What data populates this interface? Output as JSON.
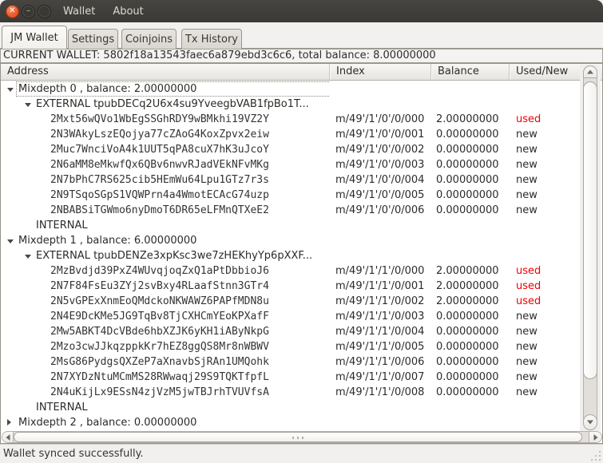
{
  "titlebar": {
    "menu": [
      "Wallet",
      "About"
    ]
  },
  "tabs": {
    "items": [
      "JM Wallet",
      "Settings",
      "Coinjoins",
      "Tx History"
    ],
    "active": "JM Wallet"
  },
  "wallet_info": "CURRENT WALLET: 5802f18a13543faec6a879ebd3c6c6, total balance: 8.00000000",
  "colors": {
    "used": "#ee0000",
    "new": "#2c2b28",
    "close_button": "#ec5b2f"
  },
  "tree": {
    "columns": [
      "Address",
      "Index",
      "Balance",
      "Used/New"
    ],
    "rows": [
      {
        "level": 0,
        "expander": "expanded",
        "label": "Mixdepth 0 , balance: 2.00000000",
        "index": "",
        "balance": "",
        "status": "",
        "focused": true
      },
      {
        "level": 1,
        "expander": "expanded",
        "label": "EXTERNAL tpubDECq2U6x4su9YveegbVAB1fpBo1T...",
        "index": "",
        "balance": "",
        "status": ""
      },
      {
        "level": 2,
        "mono": true,
        "label": "2Mxt56wQVo1WbEgSSGhRDY9wBMkhi19VZ2Y",
        "index": "m/49'/1'/0'/0/000",
        "balance": "2.00000000",
        "status": "used"
      },
      {
        "level": 2,
        "mono": true,
        "label": "2N3WAkyLszEQojya77cZAoG4KoxZpvx2eiw",
        "index": "m/49'/1'/0'/0/001",
        "balance": "0.00000000",
        "status": "new"
      },
      {
        "level": 2,
        "mono": true,
        "label": "2Muc7WnciVoA4k1UUT5qPA8cuX7hK3uJcoY",
        "index": "m/49'/1'/0'/0/002",
        "balance": "0.00000000",
        "status": "new"
      },
      {
        "level": 2,
        "mono": true,
        "label": "2N6aMM8eMkwfQx6QBv6nwvRJadVEkNFvMKg",
        "index": "m/49'/1'/0'/0/003",
        "balance": "0.00000000",
        "status": "new"
      },
      {
        "level": 2,
        "mono": true,
        "label": "2N7bPhC7RS625cib5HEmWu64Lpu1GTz7r3s",
        "index": "m/49'/1'/0'/0/004",
        "balance": "0.00000000",
        "status": "new"
      },
      {
        "level": 2,
        "mono": true,
        "label": "2N9TSqoSGpS1VQWPrn4a4WmotECAcG74uzp",
        "index": "m/49'/1'/0'/0/005",
        "balance": "0.00000000",
        "status": "new"
      },
      {
        "level": 2,
        "mono": true,
        "label": "2NBABSiTGWmo6nyDmoT6DR65eLFMnQTXeE2",
        "index": "m/49'/1'/0'/0/006",
        "balance": "0.00000000",
        "status": "new"
      },
      {
        "level": 1,
        "label": "INTERNAL",
        "index": "",
        "balance": "",
        "status": ""
      },
      {
        "level": 0,
        "expander": "expanded",
        "label": "Mixdepth 1 , balance: 6.00000000",
        "index": "",
        "balance": "",
        "status": ""
      },
      {
        "level": 1,
        "expander": "expanded",
        "label": "EXTERNAL tpubDENZe3xpKsc3we7zHEKhyYp6pXXF...",
        "index": "",
        "balance": "",
        "status": ""
      },
      {
        "level": 2,
        "mono": true,
        "label": "2MzBvdjd39PxZ4WUvqjoqZxQ1aPtDbbioJ6",
        "index": "m/49'/1'/1'/0/000",
        "balance": "2.00000000",
        "status": "used"
      },
      {
        "level": 2,
        "mono": true,
        "label": "2N7F84FsEu3ZYj2svBxy4RLaafStnn3GTr4",
        "index": "m/49'/1'/1'/0/001",
        "balance": "2.00000000",
        "status": "used"
      },
      {
        "level": 2,
        "mono": true,
        "label": "2N5vGPExXnmEoQMdckoNKWAWZ6PAPfMDN8u",
        "index": "m/49'/1'/1'/0/002",
        "balance": "2.00000000",
        "status": "used"
      },
      {
        "level": 2,
        "mono": true,
        "label": "2N4E9DcKMe5JG9TqBv8TjCXHCmYEoKPXafF",
        "index": "m/49'/1'/1'/0/003",
        "balance": "0.00000000",
        "status": "new"
      },
      {
        "level": 2,
        "mono": true,
        "label": "2Mw5ABKT4DcVBde6hbXZJK6yKH1iAByNkpG",
        "index": "m/49'/1'/1'/0/004",
        "balance": "0.00000000",
        "status": "new"
      },
      {
        "level": 2,
        "mono": true,
        "label": "2Mzo3cwJJkqzppkKr7hEZ8ggQS8Mr8nWBWV",
        "index": "m/49'/1'/1'/0/005",
        "balance": "0.00000000",
        "status": "new"
      },
      {
        "level": 2,
        "mono": true,
        "label": "2MsG86PydgsQXZeP7aXnavbSjRAn1UMQohk",
        "index": "m/49'/1'/1'/0/006",
        "balance": "0.00000000",
        "status": "new"
      },
      {
        "level": 2,
        "mono": true,
        "label": "2N7XYDzNtuMCmMS28RWwaqj29S9TQKTfpfL",
        "index": "m/49'/1'/1'/0/007",
        "balance": "0.00000000",
        "status": "new"
      },
      {
        "level": 2,
        "mono": true,
        "label": "2N4uKijLx9ESsN4zjVzM5jwTBJrhTVUVfsA",
        "index": "m/49'/1'/1'/0/008",
        "balance": "0.00000000",
        "status": "new"
      },
      {
        "level": 1,
        "label": "INTERNAL",
        "index": "",
        "balance": "",
        "status": ""
      },
      {
        "level": 0,
        "expander": "collapsed",
        "label": "Mixdepth 2 , balance: 0.00000000",
        "index": "",
        "balance": "",
        "status": ""
      }
    ]
  },
  "status_bar": {
    "text": "Wallet synced successfully."
  }
}
